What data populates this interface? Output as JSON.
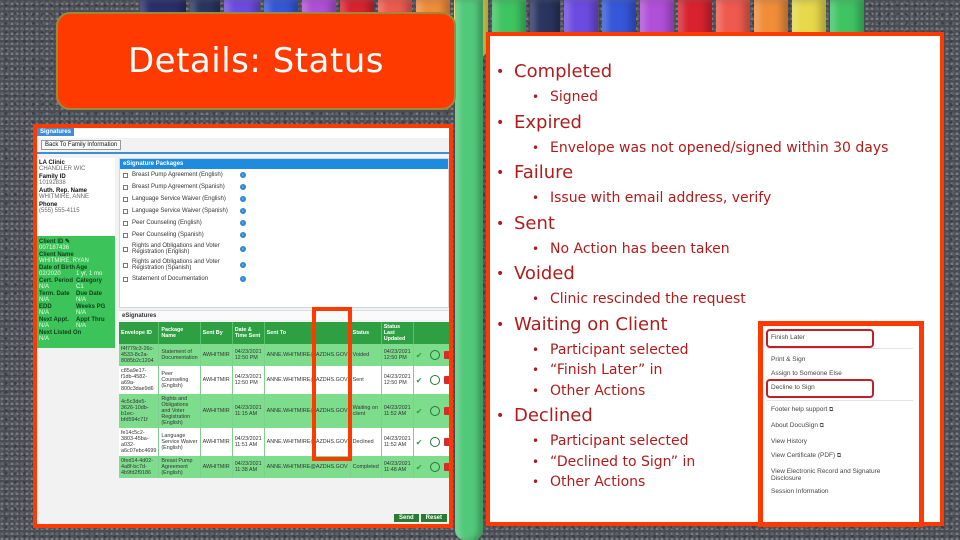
{
  "title": "Details: Status",
  "colors": {
    "accent": "#ff3a00",
    "bullet_text": "#b01c1c",
    "green_row": "#7ddd8d",
    "header_green": "#2ea043",
    "blue_header": "#1d8ce0"
  },
  "screenshot": {
    "tab_label": "Signatures",
    "back_button": "Back To Family Information",
    "info_fields": [
      {
        "label": "LA Clinic",
        "value": "CHANDLER WIC"
      },
      {
        "label": "Family ID",
        "value": "10192838"
      },
      {
        "label": "Auth. Rep. Name",
        "value": "WHITMIRE, ANNE"
      },
      {
        "label": "Phone",
        "value": "(555) 555-4115"
      }
    ],
    "client_fields": [
      [
        {
          "label": "Client ID",
          "value": "007187436",
          "icon": "edit-icon"
        }
      ],
      [
        {
          "label": "Client Name",
          "value": "WHITMIRE, RYAN"
        }
      ],
      [
        {
          "label": "Date of Birth",
          "value": "02/2020"
        },
        {
          "label": "Age",
          "value": "1 yr, 1 mo"
        }
      ],
      [
        {
          "label": "Cert. Period",
          "value": "N/A"
        },
        {
          "label": "Category",
          "value": "C1"
        }
      ],
      [
        {
          "label": "Term. Date",
          "value": "N/A"
        },
        {
          "label": "Due Date",
          "value": "N/A"
        }
      ],
      [
        {
          "label": "EDD",
          "value": "N/A"
        },
        {
          "label": "Weeks PG",
          "value": "N/A"
        }
      ],
      [
        {
          "label": "Next Appt.",
          "value": "N/A"
        },
        {
          "label": "Appt Thru",
          "value": "N/A"
        }
      ],
      [
        {
          "label": "Next Listed On",
          "value": "N/A"
        }
      ]
    ],
    "packages_header": "eSignature Packages",
    "packages": [
      "Breast Pump Agreement (English)",
      "Breast Pump Agreement (Spanish)",
      "Language Service Waiver (English)",
      "Language Service Waiver (Spanish)",
      "Peer Counseling (English)",
      "Peer Counseling (Spanish)",
      "Rights and Obligations and Voter Registration (English)",
      "Rights and Obligations and Voter Registration (Spanish)",
      "Statement of Documentation"
    ],
    "esignatures_header": "eSignatures",
    "table": {
      "columns": [
        "Envelope ID",
        "Package Name",
        "Sent By",
        "Date & Time Sent",
        "Sent To",
        "Status",
        "Status Last Updated"
      ],
      "rows": [
        {
          "envelope": "f4f779c3-26c-4533-8c2a-8085b2c1204",
          "package": "Statement of Documentation",
          "sent_by": "AWHITMIR",
          "sent": "04/23/2021 12:50 PM",
          "sent_to": "ANNE.WHITMIRE@AZDHS.GOV",
          "status": "Voided",
          "updated": "04/23/2021 12:50 PM"
        },
        {
          "envelope": "c85a9e17-f1db-4582-a69a-800c3dae9d6",
          "package": "Peer Counseling (English)",
          "sent_by": "AWHITMIR",
          "sent": "04/23/2021 12:50 PM",
          "sent_to": "ANNE.WHITMIRE@AZDHS.GOV",
          "status": "Sent",
          "updated": "04/23/2021 12:50 PM"
        },
        {
          "envelope": "4c5c3de5-3626-10db-b1ec-bfd594c71f",
          "package": "Rights and Obligations and Voter Registration (English)",
          "sent_by": "AWHITMIR",
          "sent": "04/23/2021 11:15 AM",
          "sent_to": "ANNE.WHITMIRE@AZDHS.GOV",
          "status": "Waiting on client",
          "updated": "04/23/2021 11:52 AM"
        },
        {
          "envelope": "fe14c5c2-3803-45ba-a032-a6c07ebc4699",
          "package": "Language Service Waiver (English)",
          "sent_by": "AWHITMIR",
          "sent": "04/23/2021 11:51 AM",
          "sent_to": "ANNE.WHITMIRE@AZDHS.GOV",
          "status": "Declined",
          "updated": "04/23/2021 11:52 AM"
        },
        {
          "envelope": "0fed14-4d02-4a8f-bc7d-4b9fd2f9186",
          "package": "Breast Pump Agreement (English)",
          "sent_by": "AWHITMIR",
          "sent": "04/23/2021 11:38 AM",
          "sent_to": "ANNE.WHITMIRE@AZDHS.GOV",
          "status": "Completed",
          "updated": "04/23/2021 11:48 AM"
        }
      ]
    },
    "send_button": "Send",
    "reset_button": "Reset"
  },
  "statuses": [
    {
      "name": "Completed",
      "details": [
        "Signed"
      ]
    },
    {
      "name": "Expired",
      "details": [
        "Envelope was not opened/signed within 30 days"
      ]
    },
    {
      "name": "Failure",
      "details": [
        "Issue with email address, verify"
      ]
    },
    {
      "name": "Sent",
      "details": [
        "No Action has been taken"
      ]
    },
    {
      "name": "Voided",
      "details": [
        "Clinic rescinded the request"
      ]
    },
    {
      "name": "Waiting on Client",
      "details": [
        "Participant selected",
        " “Finish Later” in",
        "Other Actions"
      ]
    },
    {
      "name": "Declined",
      "details": [
        "Participant selected",
        "“Declined to Sign” in",
        "Other Actions"
      ]
    }
  ],
  "other_actions_menu": [
    {
      "label": "Finish Later",
      "highlighted": true
    },
    {
      "label": "Print & Sign"
    },
    {
      "label": "Assign to Someone Else"
    },
    {
      "label": "Decline to Sign",
      "highlighted": true
    },
    {
      "label": "Footer help support",
      "external": true
    },
    {
      "label": "About DocuSign",
      "external": true
    },
    {
      "label": "View History"
    },
    {
      "label": "View Certificate (PDF)",
      "external": true
    },
    {
      "label": "View Electronic Record and Signature Disclosure"
    },
    {
      "label": "Session Information"
    }
  ]
}
